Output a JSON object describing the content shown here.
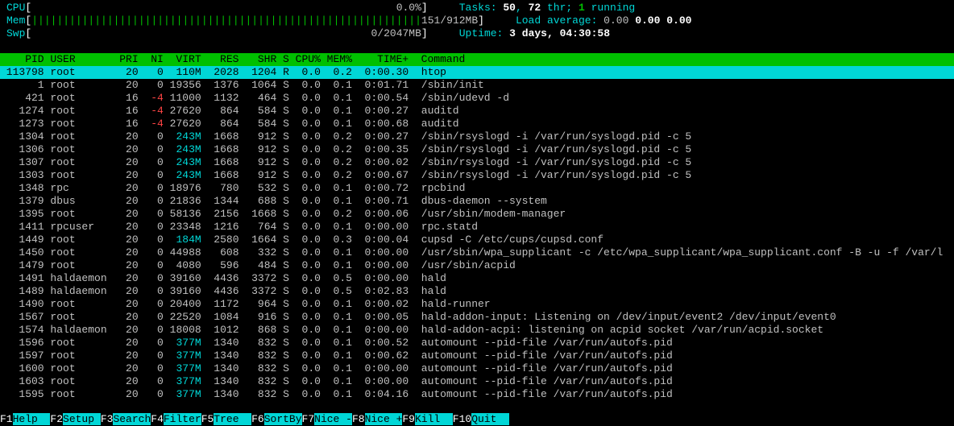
{
  "meters": {
    "cpu": {
      "label": "CPU",
      "bar": "",
      "value": "0.0%"
    },
    "mem": {
      "label": "Mem",
      "bar": "||||||||||||||||||||||||||||||||||||||||||||||||||||||||||||||",
      "value": "151/912MB"
    },
    "swp": {
      "label": "Swp",
      "bar": "",
      "value": "0/2047MB"
    }
  },
  "right": {
    "tasks_label": "Tasks: ",
    "tasks_count": "50",
    "tasks_sep": ", ",
    "threads": "72",
    "threads_suffix": " thr; ",
    "running": "1",
    "running_suffix": " running",
    "load_label": "Load average: ",
    "load1": "0.00",
    "load2": "0.00",
    "load3": "0.00",
    "uptime_label": "Uptime: ",
    "uptime_value": "3 days, 04:30:58"
  },
  "columns": {
    "pid": "PID",
    "user": "USER",
    "pri": "PRI",
    "ni": "NI",
    "virt": "VIRT",
    "res": "RES",
    "shr": "SHR",
    "s": "S",
    "cpu": "CPU%",
    "mem": "MEM%",
    "time": "TIME+",
    "command": "Command"
  },
  "processes": [
    {
      "pid": "113798",
      "user": "root",
      "pri": "20",
      "ni": "0",
      "virt": "110M",
      "res": "2028",
      "shr": "1204",
      "s": "R",
      "cpu": "0.0",
      "mem": "0.2",
      "time": "0:00.30",
      "cmd": "htop",
      "selected": true
    },
    {
      "pid": "1",
      "user": "root",
      "pri": "20",
      "ni": "0",
      "virt": "19356",
      "res": "1376",
      "shr": "1064",
      "s": "S",
      "cpu": "0.0",
      "mem": "0.1",
      "time": "0:01.71",
      "cmd": "/sbin/init"
    },
    {
      "pid": "421",
      "user": "root",
      "pri": "16",
      "ni": "-4",
      "virt": "11000",
      "res": "1132",
      "shr": "464",
      "s": "S",
      "cpu": "0.0",
      "mem": "0.1",
      "time": "0:00.54",
      "cmd": "/sbin/udevd -d"
    },
    {
      "pid": "1274",
      "user": "root",
      "pri": "16",
      "ni": "-4",
      "virt": "27620",
      "res": "864",
      "shr": "584",
      "s": "S",
      "cpu": "0.0",
      "mem": "0.1",
      "time": "0:00.27",
      "cmd": "auditd"
    },
    {
      "pid": "1273",
      "user": "root",
      "pri": "16",
      "ni": "-4",
      "virt": "27620",
      "res": "864",
      "shr": "584",
      "s": "S",
      "cpu": "0.0",
      "mem": "0.1",
      "time": "0:00.68",
      "cmd": "auditd"
    },
    {
      "pid": "1304",
      "user": "root",
      "pri": "20",
      "ni": "0",
      "virt": "243M",
      "res": "1668",
      "shr": "912",
      "s": "S",
      "cpu": "0.0",
      "mem": "0.2",
      "time": "0:00.27",
      "cmd": "/sbin/rsyslogd -i /var/run/syslogd.pid -c 5"
    },
    {
      "pid": "1306",
      "user": "root",
      "pri": "20",
      "ni": "0",
      "virt": "243M",
      "res": "1668",
      "shr": "912",
      "s": "S",
      "cpu": "0.0",
      "mem": "0.2",
      "time": "0:00.35",
      "cmd": "/sbin/rsyslogd -i /var/run/syslogd.pid -c 5"
    },
    {
      "pid": "1307",
      "user": "root",
      "pri": "20",
      "ni": "0",
      "virt": "243M",
      "res": "1668",
      "shr": "912",
      "s": "S",
      "cpu": "0.0",
      "mem": "0.2",
      "time": "0:00.02",
      "cmd": "/sbin/rsyslogd -i /var/run/syslogd.pid -c 5"
    },
    {
      "pid": "1303",
      "user": "root",
      "pri": "20",
      "ni": "0",
      "virt": "243M",
      "res": "1668",
      "shr": "912",
      "s": "S",
      "cpu": "0.0",
      "mem": "0.2",
      "time": "0:00.67",
      "cmd": "/sbin/rsyslogd -i /var/run/syslogd.pid -c 5"
    },
    {
      "pid": "1348",
      "user": "rpc",
      "pri": "20",
      "ni": "0",
      "virt": "18976",
      "res": "780",
      "shr": "532",
      "s": "S",
      "cpu": "0.0",
      "mem": "0.1",
      "time": "0:00.72",
      "cmd": "rpcbind"
    },
    {
      "pid": "1379",
      "user": "dbus",
      "pri": "20",
      "ni": "0",
      "virt": "21836",
      "res": "1344",
      "shr": "688",
      "s": "S",
      "cpu": "0.0",
      "mem": "0.1",
      "time": "0:00.71",
      "cmd": "dbus-daemon --system"
    },
    {
      "pid": "1395",
      "user": "root",
      "pri": "20",
      "ni": "0",
      "virt": "58136",
      "res": "2156",
      "shr": "1668",
      "s": "S",
      "cpu": "0.0",
      "mem": "0.2",
      "time": "0:00.06",
      "cmd": "/usr/sbin/modem-manager"
    },
    {
      "pid": "1411",
      "user": "rpcuser",
      "pri": "20",
      "ni": "0",
      "virt": "23348",
      "res": "1216",
      "shr": "764",
      "s": "S",
      "cpu": "0.0",
      "mem": "0.1",
      "time": "0:00.00",
      "cmd": "rpc.statd"
    },
    {
      "pid": "1449",
      "user": "root",
      "pri": "20",
      "ni": "0",
      "virt": "184M",
      "res": "2580",
      "shr": "1664",
      "s": "S",
      "cpu": "0.0",
      "mem": "0.3",
      "time": "0:00.04",
      "cmd": "cupsd -C /etc/cups/cupsd.conf"
    },
    {
      "pid": "1450",
      "user": "root",
      "pri": "20",
      "ni": "0",
      "virt": "44988",
      "res": "608",
      "shr": "332",
      "s": "S",
      "cpu": "0.0",
      "mem": "0.1",
      "time": "0:00.00",
      "cmd": "/usr/sbin/wpa_supplicant -c /etc/wpa_supplicant/wpa_supplicant.conf -B -u -f /var/l"
    },
    {
      "pid": "1479",
      "user": "root",
      "pri": "20",
      "ni": "0",
      "virt": "4080",
      "res": "596",
      "shr": "484",
      "s": "S",
      "cpu": "0.0",
      "mem": "0.1",
      "time": "0:00.00",
      "cmd": "/usr/sbin/acpid"
    },
    {
      "pid": "1491",
      "user": "haldaemon",
      "pri": "20",
      "ni": "0",
      "virt": "39160",
      "res": "4436",
      "shr": "3372",
      "s": "S",
      "cpu": "0.0",
      "mem": "0.5",
      "time": "0:00.00",
      "cmd": "hald"
    },
    {
      "pid": "1489",
      "user": "haldaemon",
      "pri": "20",
      "ni": "0",
      "virt": "39160",
      "res": "4436",
      "shr": "3372",
      "s": "S",
      "cpu": "0.0",
      "mem": "0.5",
      "time": "0:02.83",
      "cmd": "hald"
    },
    {
      "pid": "1490",
      "user": "root",
      "pri": "20",
      "ni": "0",
      "virt": "20400",
      "res": "1172",
      "shr": "964",
      "s": "S",
      "cpu": "0.0",
      "mem": "0.1",
      "time": "0:00.02",
      "cmd": "hald-runner"
    },
    {
      "pid": "1567",
      "user": "root",
      "pri": "20",
      "ni": "0",
      "virt": "22520",
      "res": "1084",
      "shr": "916",
      "s": "S",
      "cpu": "0.0",
      "mem": "0.1",
      "time": "0:00.05",
      "cmd": "hald-addon-input: Listening on /dev/input/event2 /dev/input/event0"
    },
    {
      "pid": "1574",
      "user": "haldaemon",
      "pri": "20",
      "ni": "0",
      "virt": "18008",
      "res": "1012",
      "shr": "868",
      "s": "S",
      "cpu": "0.0",
      "mem": "0.1",
      "time": "0:00.00",
      "cmd": "hald-addon-acpi: listening on acpid socket /var/run/acpid.socket"
    },
    {
      "pid": "1596",
      "user": "root",
      "pri": "20",
      "ni": "0",
      "virt": "377M",
      "res": "1340",
      "shr": "832",
      "s": "S",
      "cpu": "0.0",
      "mem": "0.1",
      "time": "0:00.52",
      "cmd": "automount --pid-file /var/run/autofs.pid"
    },
    {
      "pid": "1597",
      "user": "root",
      "pri": "20",
      "ni": "0",
      "virt": "377M",
      "res": "1340",
      "shr": "832",
      "s": "S",
      "cpu": "0.0",
      "mem": "0.1",
      "time": "0:00.62",
      "cmd": "automount --pid-file /var/run/autofs.pid"
    },
    {
      "pid": "1600",
      "user": "root",
      "pri": "20",
      "ni": "0",
      "virt": "377M",
      "res": "1340",
      "shr": "832",
      "s": "S",
      "cpu": "0.0",
      "mem": "0.1",
      "time": "0:00.00",
      "cmd": "automount --pid-file /var/run/autofs.pid"
    },
    {
      "pid": "1603",
      "user": "root",
      "pri": "20",
      "ni": "0",
      "virt": "377M",
      "res": "1340",
      "shr": "832",
      "s": "S",
      "cpu": "0.0",
      "mem": "0.1",
      "time": "0:00.00",
      "cmd": "automount --pid-file /var/run/autofs.pid"
    },
    {
      "pid": "1595",
      "user": "root",
      "pri": "20",
      "ni": "0",
      "virt": "377M",
      "res": "1340",
      "shr": "832",
      "s": "S",
      "cpu": "0.0",
      "mem": "0.1",
      "time": "0:04.16",
      "cmd": "automount --pid-file /var/run/autofs.pid"
    }
  ],
  "footer": [
    {
      "key": "F1",
      "label": "Help  "
    },
    {
      "key": "F2",
      "label": "Setup "
    },
    {
      "key": "F3",
      "label": "Search"
    },
    {
      "key": "F4",
      "label": "Filter"
    },
    {
      "key": "F5",
      "label": "Tree  "
    },
    {
      "key": "F6",
      "label": "SortBy"
    },
    {
      "key": "F7",
      "label": "Nice -"
    },
    {
      "key": "F8",
      "label": "Nice +"
    },
    {
      "key": "F9",
      "label": "Kill  "
    },
    {
      "key": "F10",
      "label": "Quit  "
    }
  ]
}
